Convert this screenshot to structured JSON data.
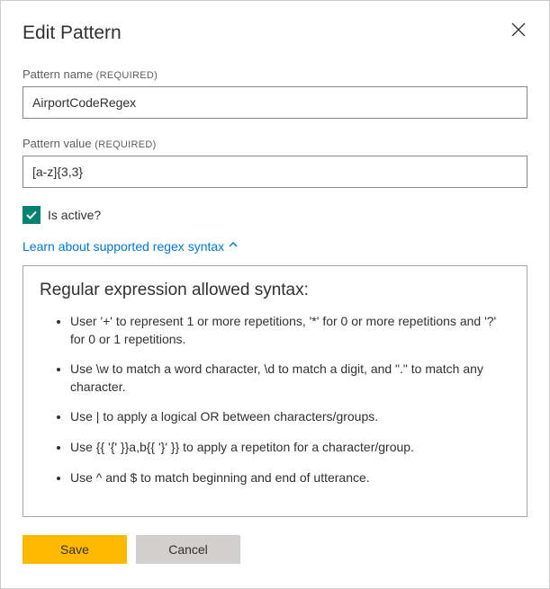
{
  "dialog": {
    "title": "Edit Pattern",
    "closeIcon": "close-icon"
  },
  "fields": {
    "name": {
      "label": "Pattern name",
      "required": "(REQUIRED)",
      "value": "AirportCodeRegex"
    },
    "value": {
      "label": "Pattern value",
      "required": "(REQUIRED)",
      "value": "[a-z]{3,3}"
    }
  },
  "isActive": {
    "checked": true,
    "label": "Is active?"
  },
  "regexLink": {
    "text": "Learn about supported regex syntax"
  },
  "syntax": {
    "title": "Regular expression allowed syntax:",
    "items": [
      "User '+' to represent 1 or more repetitions, '*' for 0 or more repetitions and '?' for 0 or 1 repetitions.",
      "Use \\w to match a word character, \\d to match a digit, and \".\" to match any character.",
      "Use | to apply a logical OR between characters/groups.",
      "Use {{ '{' }}a,b{{ '}' }} to apply a repetiton for a character/group.",
      "Use ^ and $ to match beginning and end of utterance."
    ]
  },
  "buttons": {
    "save": "Save",
    "cancel": "Cancel"
  }
}
